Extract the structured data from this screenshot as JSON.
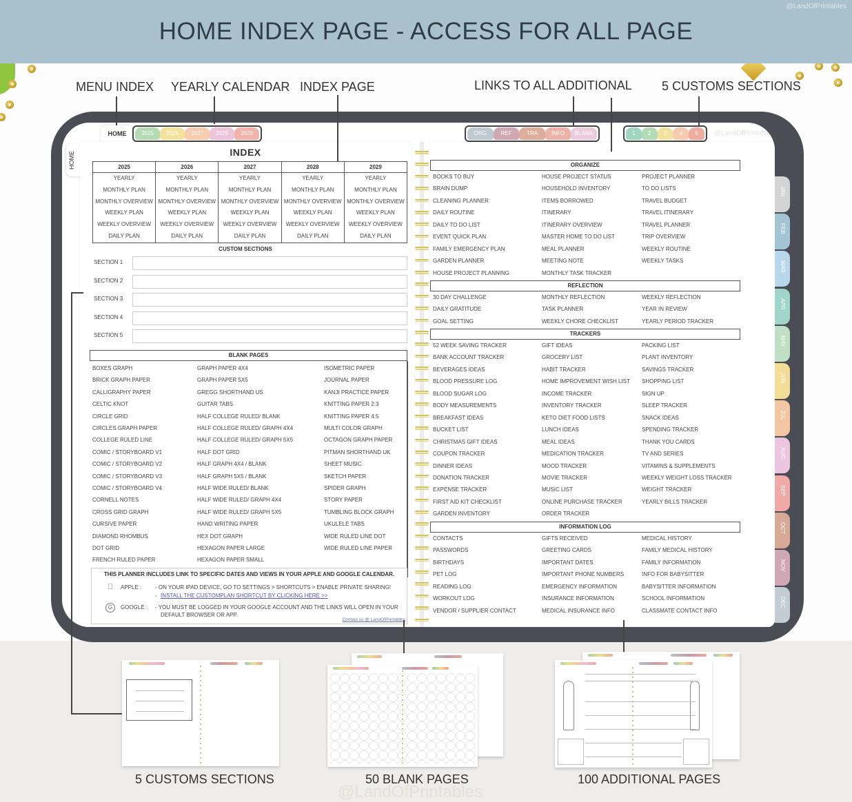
{
  "banner": {
    "title": "HOME INDEX PAGE - ACCESS FOR ALL PAGE",
    "watermark": "@LandOfPrintables"
  },
  "callouts": {
    "menu_index": "MENU INDEX",
    "yearly_calendar": "YEARLY CALENDAR",
    "index_page": "INDEX PAGE",
    "links_additional": "LINKS TO ALL ADDITIONAL",
    "customs_sections": "5 CUSTOMS SECTIONS"
  },
  "tablet": {
    "home_tab": "HOME",
    "side_home": "HOME",
    "watermark": "@LandOfPrintables",
    "year_tabs": [
      {
        "label": "2025",
        "color": "#a8d5a8"
      },
      {
        "label": "2026",
        "color": "#f2dc8e"
      },
      {
        "label": "2027",
        "color": "#f5c2a0"
      },
      {
        "label": "2028",
        "color": "#e9bcd6"
      },
      {
        "label": "2029",
        "color": "#eea79c"
      }
    ],
    "additional_tabs": [
      {
        "label": "ORG",
        "color": "#b5c1c8"
      },
      {
        "label": "REF",
        "color": "#c99aa5"
      },
      {
        "label": "TRA",
        "color": "#d6a08a"
      },
      {
        "label": "INFO",
        "color": "#eca69a"
      },
      {
        "label": "BLANK",
        "color": "#e8c4d8"
      }
    ],
    "custom_tabs": [
      {
        "label": "1",
        "color": "#8fcfb8"
      },
      {
        "label": "2",
        "color": "#a8d5a8"
      },
      {
        "label": "3",
        "color": "#f2dc8e"
      },
      {
        "label": "4",
        "color": "#f5c2a0"
      },
      {
        "label": "5",
        "color": "#ee9e90"
      }
    ],
    "month_tabs": [
      {
        "label": "JAN",
        "color": "#d4d4d4"
      },
      {
        "label": "FEB",
        "color": "#a3c4d3"
      },
      {
        "label": "MAR",
        "color": "#b8d7ea"
      },
      {
        "label": "APR",
        "color": "#9fd6c9"
      },
      {
        "label": "MAY",
        "color": "#bfe0c4"
      },
      {
        "label": "JUN",
        "color": "#f2dc96"
      },
      {
        "label": "JUL",
        "color": "#f5c6a2"
      },
      {
        "label": "AUG",
        "color": "#ecc6e0"
      },
      {
        "label": "SEP",
        "color": "#f1a9a8"
      },
      {
        "label": "OCT",
        "color": "#d7a896"
      },
      {
        "label": "NOV",
        "color": "#cfa6b4"
      },
      {
        "label": "DEC",
        "color": "#c3cbd3"
      }
    ]
  },
  "index": {
    "title": "INDEX",
    "years": [
      {
        "year": "2025",
        "items": [
          "YEARLY",
          "MONTHLY PLAN",
          "MONTHLY OVERVIEW",
          "WEEKLY PLAN",
          "WEEKLY OVERVIEW",
          "DAILY PLAN"
        ]
      },
      {
        "year": "2026",
        "items": [
          "YEARLY",
          "MONTHLY PLAN",
          "MONTHLY OVERVIEW",
          "WEEKLY PLAN",
          "WEEKLY OVERVIEW",
          "DAILY PLAN"
        ]
      },
      {
        "year": "2027",
        "items": [
          "YEARLY",
          "MONTHLY PLAN",
          "MONTHLY OVERVIEW",
          "WEEKLY PLAN",
          "WEEKLY OVERVIEW",
          "DAILY PLAN"
        ]
      },
      {
        "year": "2028",
        "items": [
          "YEARLY",
          "MONTHLY PLAN",
          "MONTHLY OVERVIEW",
          "WEEKLY PLAN",
          "WEEKLY OVERVIEW",
          "DAILY PLAN"
        ]
      },
      {
        "year": "2029",
        "items": [
          "YEARLY",
          "MONTHLY PLAN",
          "MONTHLY OVERVIEW",
          "WEEKLY PLAN",
          "WEEKLY OVERVIEW",
          "DAILY PLAN"
        ]
      }
    ],
    "custom_sections": {
      "title": "CUSTOM SECTIONS",
      "sections": [
        {
          "label": "SECTION 1",
          "value": ""
        },
        {
          "label": "SECTION 2",
          "value": ""
        },
        {
          "label": "SECTION 3",
          "value": ""
        },
        {
          "label": "SECTION 4",
          "value": ""
        },
        {
          "label": "SECTION 5",
          "value": ""
        }
      ]
    },
    "blank_pages": {
      "title": "BLANK PAGES",
      "columns": [
        [
          "BOXES GRAPH",
          "BRICK GRAPH PAPER",
          "CALLIGRAPHY PAPER",
          "CELTIC KNOT",
          "CIRCLE GRID",
          "CIRCLES GRAPH PAPER",
          "COLLEGE RULED LINE",
          "COMIC / STORYBOARD V1",
          "COMIC / STORYBOARD V2",
          "COMIC / STORYBOARD V3",
          "COMIC / STORYBOARD V4",
          "CORNELL NOTES",
          "CROSS GRID GRAPH",
          "CURSIVE PAPER",
          "DIAMOND RHOMBUS",
          "DOT GRID",
          "FRENCH RULED PAPER"
        ],
        [
          "GRAPH PAPER 4X4",
          "GRAPH PAPER 5X5",
          "GREGG SHORTHAND US",
          "GUITAR TABS",
          "HALF COLLEGE RULED/ BLANK",
          "HALF COLLEGE RULED/ GRAPH 4X4",
          "HALF COLLEGE RULED/ GRAPH 5X5",
          "HALF DOT GRID",
          "HALF GRAPH 4X4 / BLANK",
          "HALF GRAPH 5X5 / BLANK",
          "HALF WIDE RULED/ BLANK",
          "HALF WIDE RULED/ GRAPH 4X4",
          "HALF WIDE RULED/ GRAPH 5X5",
          "HAND WRITING PAPER",
          "HEX DOT GRAPH",
          "HEXAGON PAPER LARGE",
          "HEXAGON PAPER SMALL"
        ],
        [
          "ISOMETRIC PAPER",
          "JOURNAL PAPER",
          "KANJI PRACTICE PAPER",
          "KNITTING PAPER 2:3",
          "KNITTING PAPER 4:5",
          "MULTI COLOR GRAPH",
          "OCTAGON GRAPH PAPER",
          "PITMAN SHORTHAND UK",
          "SHEET MUSIC",
          "SKETCH PAPER",
          "SPIDER GRAPH",
          "STORY PAPER",
          "TUMBLING BLOCK GRAPH",
          "UKULELE TABS",
          "WIDE RULED LINE DOT",
          "WIDE RULED LINE PAPER"
        ]
      ]
    },
    "calendar_note": {
      "title": "THIS PLANNER INCLUDES LINK TO SPECIFIC DATES AND VIEWS IN YOUR APPLE AND GOOGLE CALENDAR.",
      "apple_label": "APPLE :",
      "apple_line1": "-  ON YOUR IPAD DEVICE, GO TO SETTINGS > SHORTCUTS > ENABLE PRIVATE SHARING!",
      "apple_link_prefix": "-",
      "apple_link": "INSTALL THE CUSTOMPLAN SHORTCUT BY CLICKING HERE >>",
      "google_label": "GOOGLE :",
      "google_line1": "-  YOU MUST BE LOGGED IN YOUR GOOGLE ACCOUNT AND THE LINKS WILL OPEN IN YOUR",
      "google_line2": "DEFAULT BROWSER OR APP.",
      "apple_icon": "apple-icon",
      "google_icon": "google-icon",
      "contact": "Contact us @ LandOfPrintables"
    }
  },
  "additional": {
    "sections": [
      {
        "title": "ORGANIZE",
        "columns": [
          [
            "BOOKS TO BUY",
            "BRAIN DUMP",
            "CLEANING PLANNER",
            "DAILY ROUTINE",
            "DAILY TO DO LIST",
            "EVENT QUICK PLAN",
            "FAMILY EMERGENCY PLAN",
            "GARDEN PLANNER",
            "HOUSE PROJECT PLANNING"
          ],
          [
            "HOUSE PROJECT STATUS",
            "HOUSEHOLD INVENTORY",
            "ITEMS BORROWED",
            "ITINERARY",
            "ITINERARY OVERVIEW",
            "MASTER HOME TO DO LIST",
            "MEAL PLANNER",
            "MEETING NOTE",
            "MONTHLY TASK TRACKER"
          ],
          [
            "PROJECT PLANNER",
            "TO DO LISTS",
            "TRAVEL BUDGET",
            "TRAVEL ITINERARY",
            "TRAVEL PLANNER",
            "TRIP OVERVIEW",
            "WEEKLY ROUTINE",
            "WEEKLY TASKS"
          ]
        ]
      },
      {
        "title": "REFLECTION",
        "columns": [
          [
            "30 DAY CHALLENGE",
            "DAILY GRATITUDE",
            "GOAL SETTING"
          ],
          [
            "MONTHLY REFLECTION",
            "TASK PLANNER",
            "WEEKLY CHORE CHECKLIST"
          ],
          [
            "WEEKLY REFLECTION",
            "YEAR IN REVIEW",
            "YEARLY PERIOD TRACKER"
          ]
        ]
      },
      {
        "title": "TRACKERS",
        "columns": [
          [
            "52 WEEK SAVING TRACKER",
            "BANK ACCOUNT TRACKER",
            "BEVERAGES IDEAS",
            "BLOOD PRESSURE LOG",
            "BLOOD SUGAR LOG",
            "BODY MEASUREMENTS",
            "BREAKFAST IDEAS",
            "BUCKET LIST",
            "CHRISTMAS GIFT IDEAS",
            "COUPON TRACKER",
            "DINNER IDEAS",
            "DONATION TRACKER",
            "EXPENSE TRACKER",
            "FIRST AID KIT CHECKLIST",
            "GARDEN INVENTORY"
          ],
          [
            "GIFT IDEAS",
            "GROCERY LIST",
            "HABIT TRACKER",
            "HOME IMPROVEMENT WISH LIST",
            "INCOME TRACKER",
            "INVENTORY TRACKER",
            "KETO DIET FOOD LISTS",
            "LUNCH IDEAS",
            "MEAL IDEAS",
            "MEDICATION TRACKER",
            "MOOD TRACKER",
            "MOVIE TRACKER",
            "MUSIC LIST",
            "ONLINE PURCHASE TRACKER",
            "ORDER TRACKER"
          ],
          [
            "PACKING LIST",
            "PLANT INVENTORY",
            "SAVINGS TRACKER",
            "SHOPPING LIST",
            "SIGN UP",
            "SLEEP TRACKER",
            "SNACK IDEAS",
            "SPENDING TRACKER",
            "THANK YOU CARDS",
            "TV AND SERIES",
            "VITAMINS & SUPPLEMENTS",
            "WEEKLY WEIGHT LOSS TRACKER",
            "WEIGHT TRACKER",
            "YEARLY BILLS TRACKER"
          ]
        ]
      },
      {
        "title": "INFORMATION LOG",
        "columns": [
          [
            "CONTACTS",
            "PASSWORDS",
            "BIRTHDAYS",
            "PET LOG",
            "READING LOG",
            "WORKOUT LOG",
            "VENDOR / SUPPLIER CONTACT"
          ],
          [
            "GIFTS RECEIVED",
            "GREETING CARDS",
            "IMPORTANT DATES",
            "IMPORTANT PHONE NUMBERS",
            "EMERGENCY INFORMATION",
            "INSURANCE INFORMATION",
            "MEDICAL INSURANCE INFO"
          ],
          [
            "MEDICAL HISTORY",
            "FAMILY MEDICAL HISTORY",
            "FAMILY INFORMATION",
            "INFO FOR BABYSITTER",
            "BABYSITTER INFORMATION",
            "SCHOOL INFORMATION",
            "CLASSMATE CONTACT INFO"
          ]
        ]
      }
    ]
  },
  "previews": {
    "customs": "5 CUSTOMS SECTIONS",
    "blank": "50 BLANK PAGES",
    "additional": "100 ADDITIONAL PAGES",
    "watermark": "@LandOfPrintables"
  }
}
